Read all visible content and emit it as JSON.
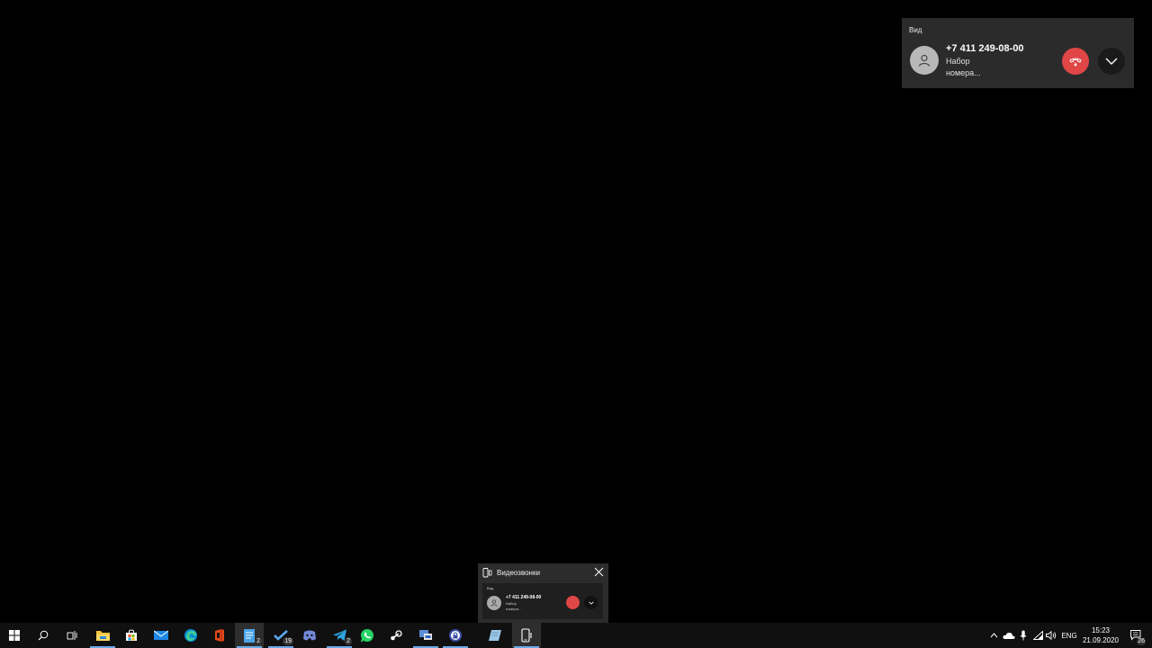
{
  "call_window": {
    "title": "Вид",
    "number": "+7 411 249-08-00",
    "status": "Набор номера..."
  },
  "preview": {
    "title": "Видеозвонки",
    "mini_title": "Вид",
    "mini_number": "+7 411 249-08-00",
    "mini_status": "Набор номера..."
  },
  "taskbar": {
    "apps": [
      {
        "name": "start-icon"
      },
      {
        "name": "search-icon"
      },
      {
        "name": "task-view-icon"
      },
      {
        "name": "file-explorer-icon"
      },
      {
        "name": "store-icon"
      },
      {
        "name": "mail-icon"
      },
      {
        "name": "edge-icon"
      },
      {
        "name": "office-icon"
      },
      {
        "name": "notepad-icon",
        "badge": "2"
      },
      {
        "name": "todo-icon",
        "badge": "19"
      },
      {
        "name": "discord-icon"
      },
      {
        "name": "telegram-icon",
        "badge": "2"
      },
      {
        "name": "whatsapp-icon"
      },
      {
        "name": "steam-icon"
      },
      {
        "name": "remote-desktop-icon"
      },
      {
        "name": "vpn-icon"
      },
      {
        "name": "paper-icon"
      },
      {
        "name": "your-phone-icon"
      }
    ],
    "tray": {
      "language": "ENG",
      "time": "15:23",
      "date": "21.09.2020",
      "notification_count": "26"
    }
  }
}
